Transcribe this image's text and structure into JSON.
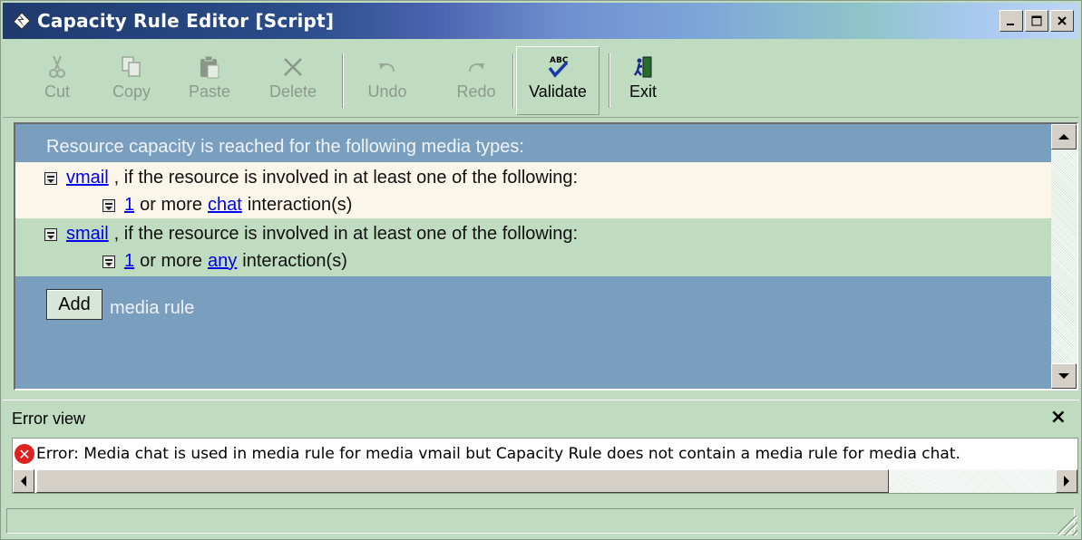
{
  "window": {
    "title": "Capacity Rule Editor [Script]",
    "controls": {
      "minimize": "_",
      "maximize": "□",
      "close": "×"
    }
  },
  "toolbar": {
    "items": [
      {
        "label": "Cut",
        "icon": "scissors-icon",
        "enabled": false
      },
      {
        "label": "Copy",
        "icon": "copy-icon",
        "enabled": false
      },
      {
        "label": "Paste",
        "icon": "paste-icon",
        "enabled": false
      },
      {
        "label": "Delete",
        "icon": "delete-x-icon",
        "enabled": false
      },
      {
        "label": "Undo",
        "icon": "undo-icon",
        "enabled": false
      },
      {
        "label": "Redo",
        "icon": "redo-icon",
        "enabled": false
      },
      {
        "label": "Validate",
        "icon": "spellcheck-icon",
        "enabled": true
      },
      {
        "label": "Exit",
        "icon": "exit-door-icon",
        "enabled": true
      }
    ]
  },
  "editor": {
    "heading": "Resource capacity is reached for the following media types:",
    "rules": [
      {
        "media": "vmail",
        "condition_text": ", if the resource is involved in at least one of the following:",
        "sub": {
          "count": "1",
          "mid_text": "or more",
          "media": "chat",
          "tail_text": "interaction(s)"
        }
      },
      {
        "media": "smail",
        "condition_text": ", if the resource is involved in at least one of the following:",
        "sub": {
          "count": "1",
          "mid_text": "or more",
          "media": "any",
          "tail_text": "interaction(s)"
        }
      }
    ],
    "add_button": "Add",
    "add_label": "media rule"
  },
  "error_view": {
    "title": "Error view",
    "close": "×",
    "message": "Error: Media chat is used in media rule for media vmail but Capacity Rule does not contain a media rule for media chat."
  },
  "colors": {
    "editor_bg": "#7a9ebe",
    "rule1_bg": "#fbf6ea",
    "rule2_bg": "#c0dcc0",
    "link": "#0000ee",
    "error_icon": "#dd2222"
  }
}
